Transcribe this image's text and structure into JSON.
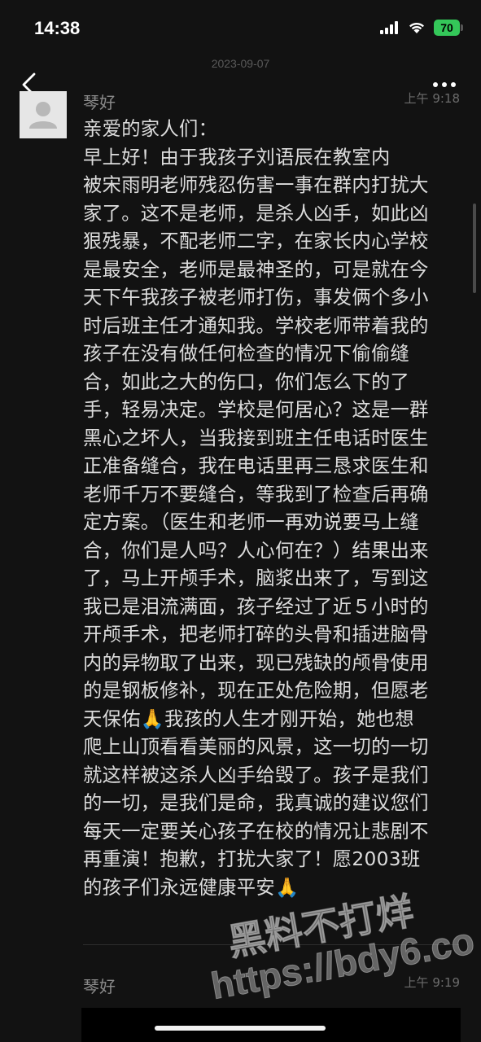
{
  "status_bar": {
    "time": "14:38",
    "battery": "70"
  },
  "date_separator": "2023-09-07",
  "messages": [
    {
      "sender": "琴好",
      "time": "上午 9:18",
      "lines": [
        "亲爱的家人们：",
        "    早上好！由于我孩子刘语辰在教室内",
        "被宋雨明老师残忍伤害一事在群内打扰大",
        "家了。这不是老师，是杀人凶手，如此凶",
        "狠残暴，不配老师二字，在家长内心学校",
        "是最安全，老师是最神圣的，可是就在今",
        "天下午我孩子被老师打伤，事发俩个多小",
        "时后班主任才通知我。学校老师带着我的",
        "孩子在没有做任何检查的情况下偷偷缝",
        "合，如此之大的伤口，你们怎么下的了",
        "手，轻易决定。学校是何居心？这是一群",
        "黑心之坏人，当我接到班主任电话时医生",
        "正准备缝合，我在电话里再三恳求医生和",
        "老师千万不要缝合，等我到了检查后再确",
        "定方案。（医生和老师一再劝说要马上缝",
        "合，你们是人吗？人心何在？）结果出来",
        "了，马上开颅手术，脑浆出来了，写到这",
        "我已是泪流满面，孩子经过了近５小时的",
        "开颅手术，把老师打碎的头骨和插进脑骨",
        "内的异物取了出来，现已残缺的颅骨使用",
        "的是钢板修补，现在正处危险期，但愿老",
        "天保佑🙏我孩的人生才刚开始，她也想",
        "爬上山顶看看美丽的风景，这一切的一切",
        "就这样被这杀人凶手给毁了。孩子是我们",
        "的一切，是我们是命，我真诚的建议您们",
        "每天一定要关心孩子在校的情况让悲剧不",
        "再重演！抱歉，打扰大家了！愿2003班",
        "的孩子们永远健康平安🙏"
      ]
    },
    {
      "sender": "琴好",
      "time": "上午 9:19"
    }
  ],
  "watermark": {
    "line1": "黑料不打烊",
    "line2": "https://bdy6.co"
  },
  "colors": {
    "background": "#121212",
    "battery": "#34c759",
    "text": "#dcdcdc"
  },
  "icons": {
    "back": "chevron-left-icon",
    "more": "more-dots-icon",
    "signal": "signal-icon",
    "wifi": "wifi-icon",
    "avatar": "default-avatar-icon"
  }
}
